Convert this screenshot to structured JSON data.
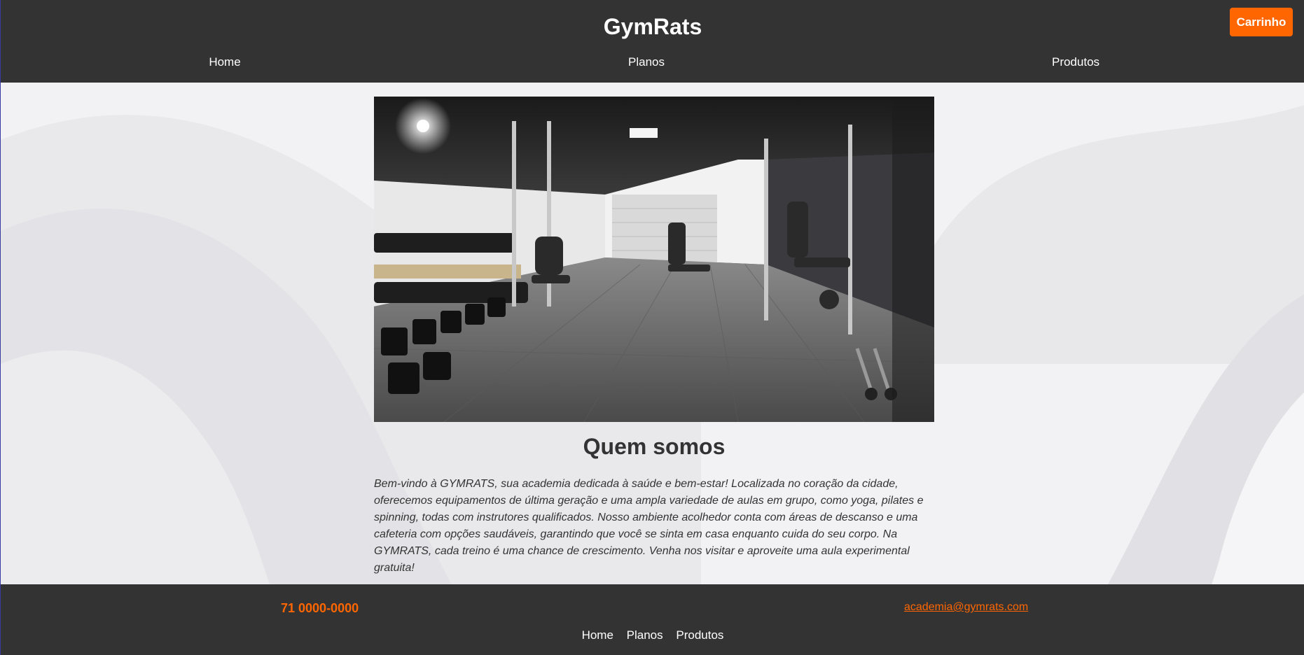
{
  "header": {
    "title": "GymRats",
    "cart_label": "Carrinho",
    "nav": [
      "Home",
      "Planos",
      "Produtos"
    ]
  },
  "main": {
    "heading": "Quem somos",
    "text": "Bem-vindo à GYMRATS, sua academia dedicada à saúde e bem-estar! Localizada no coração da cidade, oferecemos equipamentos de última geração e uma ampla variedade de aulas em grupo, como yoga, pilates e spinning, todas com instrutores qualificados. Nosso ambiente acolhedor conta com áreas de descanso e uma cafeteria com opções saudáveis, garantindo que você se sinta em casa enquanto cuida do seu corpo. Na GYMRATS, cada treino é uma chance de crescimento. Venha nos visitar e aproveite uma aula experimental gratuita!"
  },
  "footer": {
    "phone": "71 0000-0000",
    "email": "academia@gymrats.com",
    "nav": [
      "Home",
      "Planos",
      "Produtos"
    ]
  },
  "colors": {
    "accent": "#ff6600",
    "header_bg": "#333333",
    "text": "#333333"
  }
}
